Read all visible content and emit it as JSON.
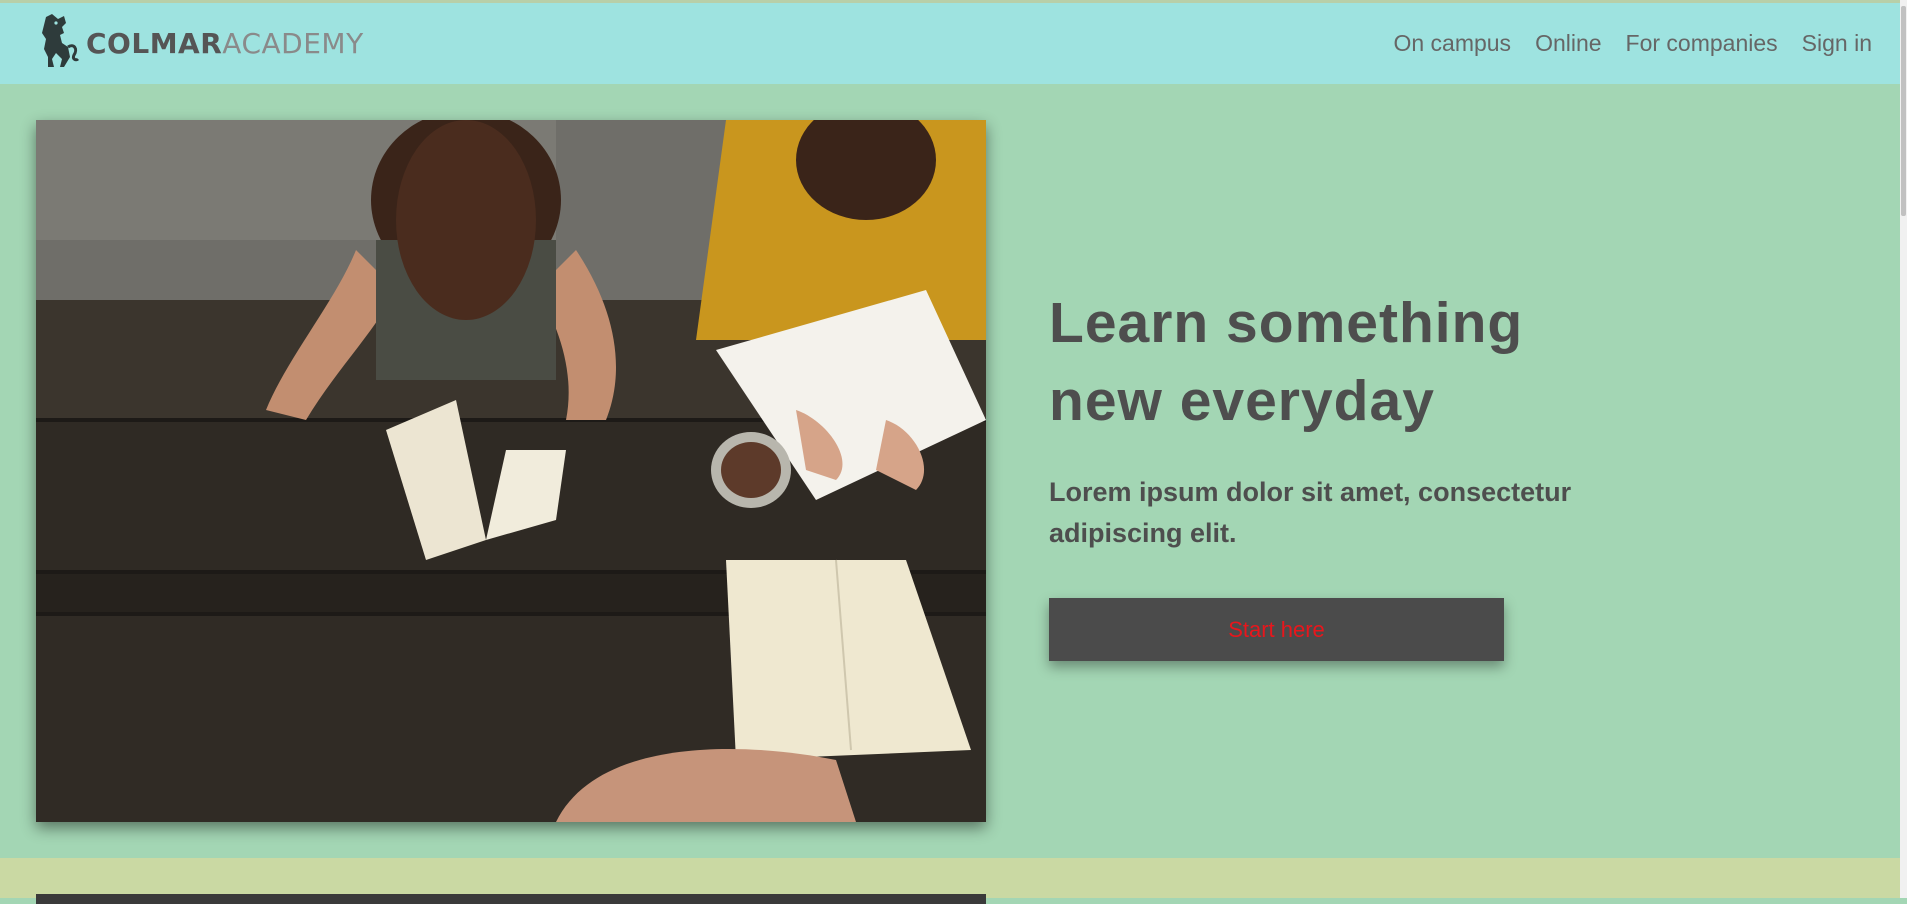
{
  "header": {
    "logo_bold": "COLMAR",
    "logo_light": "ACADEMY",
    "logo_icon": "lion-icon",
    "nav": [
      {
        "label": "On campus"
      },
      {
        "label": "Online"
      },
      {
        "label": "For companies"
      },
      {
        "label": "Sign in"
      }
    ]
  },
  "hero": {
    "image": "students-studying-photo",
    "heading": "Learn something new everyday",
    "subtext": "Lorem ipsum dolor sit amet, consectetur adipiscing elit.",
    "cta_label": "Start here"
  },
  "colors": {
    "header_bg": "#9ee3e0",
    "hero_bg": "#a3d6b4",
    "next_section_bg": "#cad9a3",
    "text": "#4e4e4e",
    "button_bg": "#4b4b4b",
    "button_text": "#e8161c"
  }
}
